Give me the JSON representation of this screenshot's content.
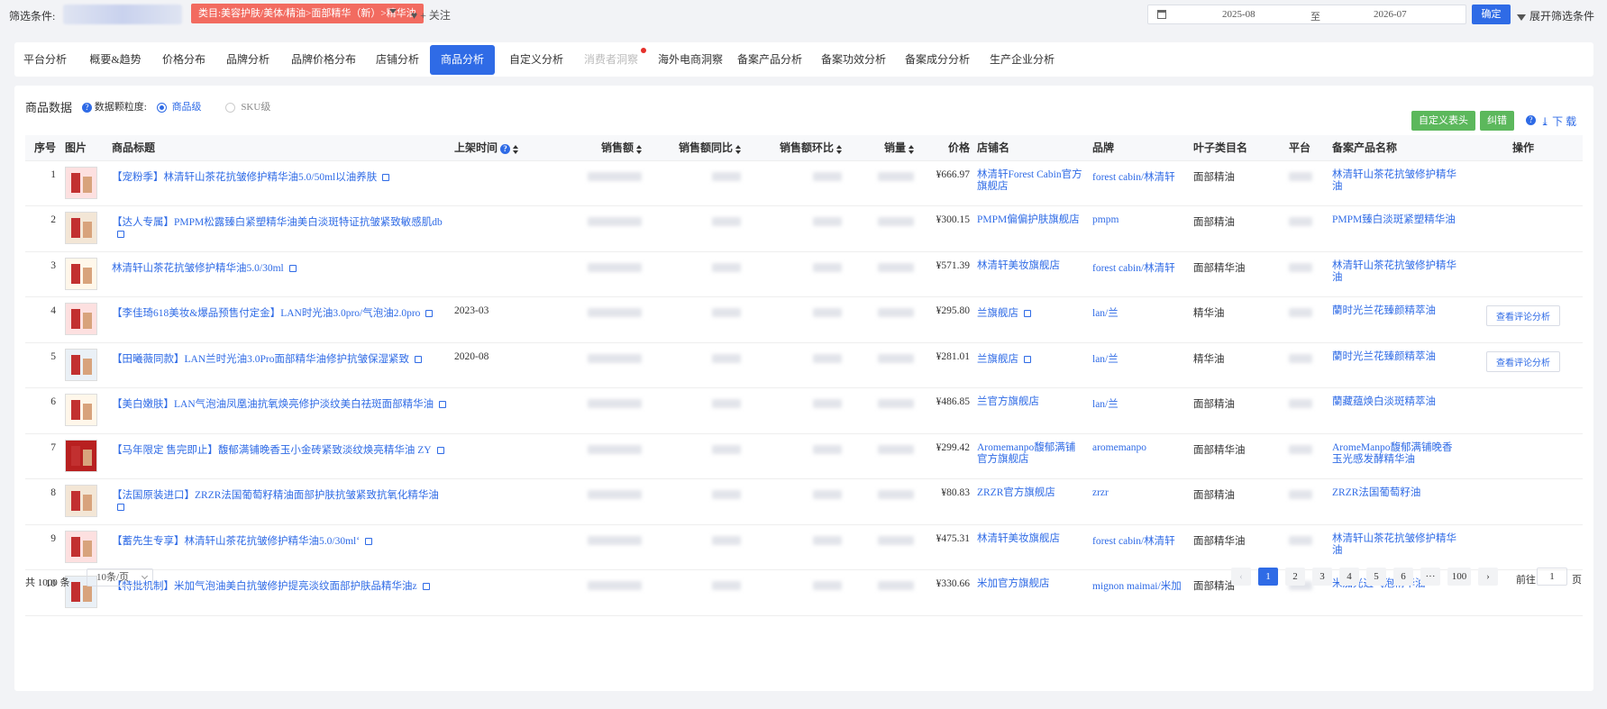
{
  "filter": {
    "label": "筛选条件:",
    "category_tag": "类目:美容护肤/美体/精油>面部精华（新）>精华油",
    "follow": "+ 关注",
    "date_start": "2025-08",
    "date_sep": "至",
    "date_end": "2026-07",
    "confirm": "确定",
    "expand": "展开筛选条件"
  },
  "tabs": [
    {
      "label": "平台分析"
    },
    {
      "label": "概要&趋势"
    },
    {
      "label": "价格分布"
    },
    {
      "label": "品牌分析"
    },
    {
      "label": "品牌价格分布"
    },
    {
      "label": "店铺分析"
    },
    {
      "label": "商品分析",
      "active": true
    },
    {
      "label": "自定义分析"
    },
    {
      "label": "消费者洞察",
      "disabled": true
    },
    {
      "label": "海外电商洞察"
    },
    {
      "label": "备案产品分析"
    },
    {
      "label": "备案功效分析"
    },
    {
      "label": "备案成分分析"
    },
    {
      "label": "生产企业分析"
    }
  ],
  "panel": {
    "title": "商品数据",
    "granularity_label": "数据颗粒度:",
    "opt_item": "商品级",
    "opt_sku": "SKU级",
    "btn_custom_header": "自定义表头",
    "btn_bulk": "纠错",
    "download": "下 载"
  },
  "columns": {
    "idx": "序号",
    "img": "图片",
    "title": "商品标题",
    "listed": "上架时间",
    "sales_amt": "销售额",
    "yoy": "销售额同比",
    "mom": "销售额环比",
    "qty": "销量",
    "price": "价格",
    "shop": "店铺名",
    "brand": "品牌",
    "leaf": "叶子类目名",
    "platform": "平台",
    "record": "备案产品名称",
    "ops": "操作"
  },
  "rows": [
    {
      "idx": "1",
      "title": "【宠粉季】林清轩山茶花抗皱修护精华油5.0/50ml以油养肤",
      "listed": "",
      "price": "¥666.97",
      "shop": "林清轩Forest Cabin官方旗舰店",
      "brand": "forest cabin/林清轩",
      "leaf": "面部精油",
      "record": "林清轩山茶花抗皱修护精华油",
      "op": ""
    },
    {
      "idx": "2",
      "title": "【达人专属】PMPM松露臻白紧塑精华油美白淡斑特证抗皱紧致敏感肌db",
      "listed": "",
      "price": "¥300.15",
      "shop": "PMPM偏偏护肤旗舰店",
      "brand": "pmpm",
      "leaf": "面部精油",
      "record": "PMPM臻白淡斑紧塑精华油",
      "op": ""
    },
    {
      "idx": "3",
      "title": "林清轩山茶花抗皱修护精华油5.0/30ml",
      "listed": "",
      "price": "¥571.39",
      "shop": "林清轩美妆旗舰店",
      "brand": "forest cabin/林清轩",
      "leaf": "面部精华油",
      "record": "林清轩山茶花抗皱修护精华油",
      "op": ""
    },
    {
      "idx": "4",
      "title": "【李佳琦618美妆&爆品预售付定金】LAN时光油3.0pro/气泡油2.0pro",
      "listed": "2023-03",
      "price": "¥295.80",
      "shop": "兰旗舰店",
      "brand": "lan/兰",
      "leaf": "精华油",
      "record": "蘭时光兰花臻颜精萃油",
      "op": "查看评论分析"
    },
    {
      "idx": "5",
      "title": "【田曦薇同款】LAN兰时光油3.0Pro面部精华油修护抗皱保湿紧致",
      "listed": "2020-08",
      "price": "¥281.01",
      "shop": "兰旗舰店",
      "brand": "lan/兰",
      "leaf": "精华油",
      "record": "蘭时光兰花臻颜精萃油",
      "op": "查看评论分析"
    },
    {
      "idx": "6",
      "title": "【美白嫩肤】LAN气泡油凤凰油抗氧焕亮修护淡纹美白祛斑面部精华油",
      "listed": "",
      "price": "¥486.85",
      "shop": "兰官方旗舰店",
      "brand": "lan/兰",
      "leaf": "面部精油",
      "record": "蘭藏蕴焕白淡斑精萃油",
      "op": ""
    },
    {
      "idx": "7",
      "title": "【马年限定 售完即止】馥郁满铺晚香玉小金砖紧致淡纹焕亮精华油 ZY",
      "listed": "",
      "price": "¥299.42",
      "shop": "Aromemanpo馥郁满铺官方旗舰店",
      "brand": "aromemanpo",
      "leaf": "面部精华油",
      "record": "AromeManpo馥郁满铺晚香玉光感发酵精华油",
      "op": ""
    },
    {
      "idx": "8",
      "title": "【法国原装进口】ZRZR法国葡萄籽精油面部护肤抗皱紧致抗氧化精华油",
      "listed": "",
      "price": "¥80.83",
      "shop": "ZRZR官方旗舰店",
      "brand": "zrzr",
      "leaf": "面部精油",
      "record": "ZRZR法国葡萄籽油",
      "op": ""
    },
    {
      "idx": "9",
      "title": "【蓄先生专享】林清轩山茶花抗皱修护精华油5.0/30ml‘",
      "listed": "",
      "price": "¥475.31",
      "shop": "林清轩美妆旗舰店",
      "brand": "forest cabin/林清轩",
      "leaf": "面部精华油",
      "record": "林清轩山茶花抗皱修护精华油",
      "op": ""
    },
    {
      "idx": "10",
      "title": "【特批机制】米加气泡油美白抗皱修护提亮淡纹面部护肤品精华油z",
      "listed": "",
      "price": "¥330.66",
      "shop": "米加官方旗舰店",
      "brand": "mignon maimai/米加",
      "leaf": "面部精油",
      "record": "米加光透气泡精华油",
      "op": ""
    }
  ],
  "footer": {
    "total": "共 1000 条",
    "page_size": "10条/页",
    "pages": [
      "1",
      "2",
      "3",
      "4",
      "5",
      "6",
      "···",
      "100"
    ],
    "goto_prefix": "前往",
    "goto_value": "1",
    "goto_suffix": "页"
  }
}
